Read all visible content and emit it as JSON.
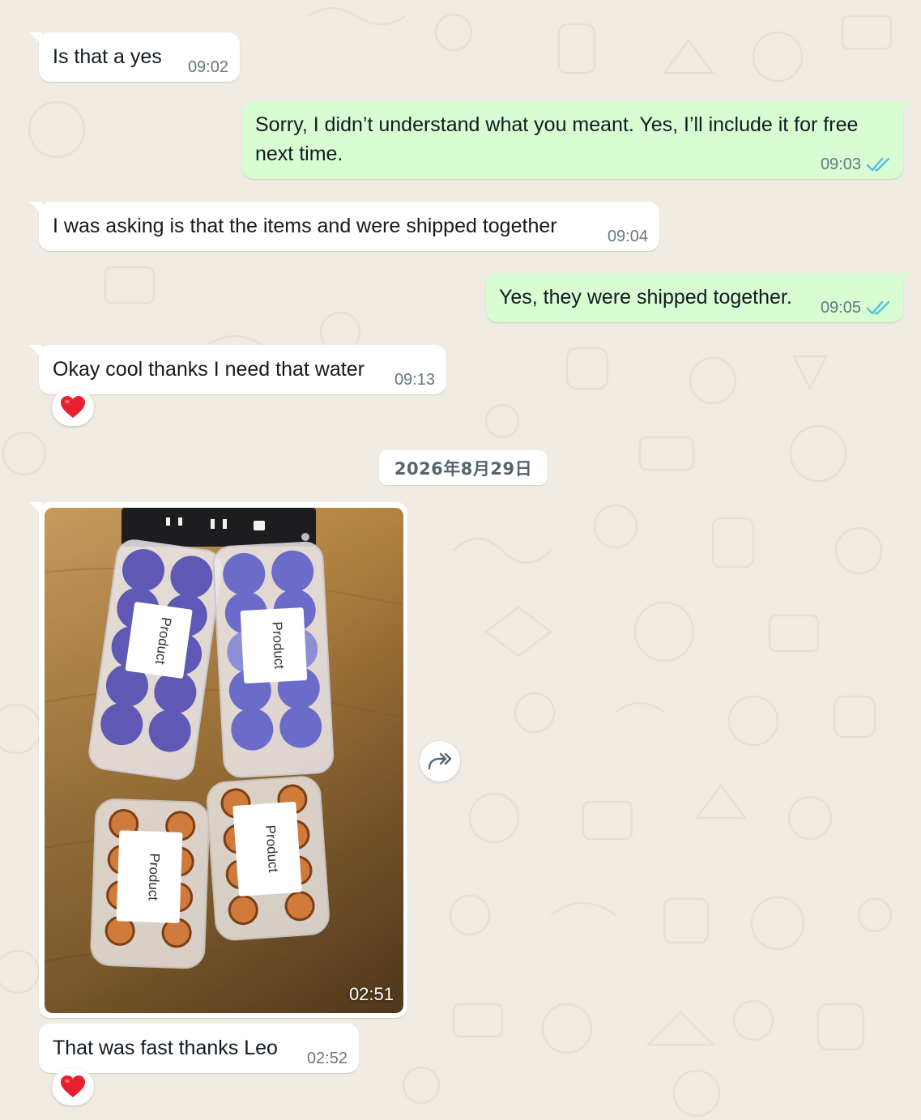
{
  "chat": {
    "messages": [
      {
        "id": "m1",
        "direction": "incoming",
        "text": "Is that a yes",
        "time": "09:02"
      },
      {
        "id": "m2",
        "direction": "outgoing",
        "text_lines": [
          "Sorry, I didn’t understand what you meant. Yes, I’ll include it for free",
          "next time."
        ],
        "time": "09:03",
        "status": "read"
      },
      {
        "id": "m3",
        "direction": "incoming",
        "text": "I was asking is that the items and were shipped together",
        "time": "09:04"
      },
      {
        "id": "m4",
        "direction": "outgoing",
        "text": "Yes, they were shipped together.",
        "time": "09:05",
        "status": "read"
      },
      {
        "id": "m5",
        "direction": "incoming",
        "text": "Okay cool thanks I need that water",
        "time": "09:13",
        "reaction": "heart"
      },
      {
        "id": "m6",
        "direction": "incoming",
        "type": "image",
        "time": "02:51",
        "image_labels": [
          "Product",
          "Product",
          "Product",
          "Product"
        ]
      },
      {
        "id": "m7",
        "direction": "incoming",
        "text": "That was fast thanks Leo",
        "time": "02:52",
        "reaction": "heart"
      }
    ],
    "date_divider": "2026年8月29日"
  },
  "icons": {
    "read_receipt": "double-check-icon",
    "reaction": "heart-icon",
    "forward": "forward-icon"
  },
  "colors": {
    "wallpaper": "#f0ece4",
    "incoming_bubble": "#ffffff",
    "outgoing_bubble": "#d9fdd3",
    "read_ticks": "#53bdeb",
    "meta_text": "#667781",
    "heart": "#e8202e"
  }
}
